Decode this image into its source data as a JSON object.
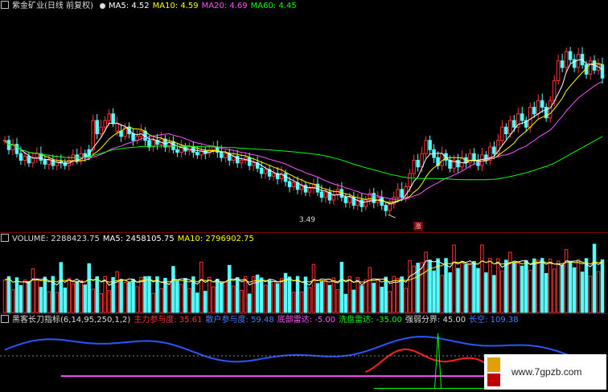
{
  "price_panel": {
    "stock_name": "紫金矿业(日线 前复权)",
    "ma_labels": [
      {
        "text": "MA5: 4.52",
        "color": "#ffffff"
      },
      {
        "text": "MA10: 4.59",
        "color": "#ffff00"
      },
      {
        "text": "MA20: 4.69",
        "color": "#ff55ff"
      },
      {
        "text": "MA60: 4.45",
        "color": "#00ff00"
      }
    ],
    "low_marker": "3.49",
    "badge": "涨"
  },
  "volume_panel": {
    "labels": [
      {
        "text": "VOLUME: 2288423.75",
        "color": "#dddddd"
      },
      {
        "text": "MA5: 2458105.75",
        "color": "#ffffff"
      },
      {
        "text": "MA10: 2796902.75",
        "color": "#ffff00"
      }
    ]
  },
  "indicator_panel": {
    "labels": [
      {
        "text": "黑客长刀指标(6,14,95,250,1,2)",
        "color": "#dddddd"
      },
      {
        "text": "主力参与度: 35.61",
        "color": "#ff3030"
      },
      {
        "text": "散户参与度: 59.48",
        "color": "#4a7dff"
      },
      {
        "text": "底部雷达: -5.00",
        "color": "#ff55ff"
      },
      {
        "text": "洗盘雷达: -35.00",
        "color": "#00ff00"
      },
      {
        "text": "强弱分界: 45.00",
        "color": "#dddddd"
      },
      {
        "text": "长空: 109.38",
        "color": "#4a7dff"
      }
    ]
  },
  "watermark": {
    "text": "www.7gpzb.com"
  },
  "colors": {
    "up": "#ff3232",
    "down": "#54ffff",
    "ma5": "#ffffff",
    "ma10": "#ffff00",
    "ma20": "#ff55ff",
    "ma60": "#00ff00",
    "main": "#ff2020",
    "retail": "#2a55ff"
  },
  "chart_data": [
    {
      "type": "candlestick",
      "title": "紫金矿业(日线 前复权)",
      "n": 150,
      "ylim": [
        3.4,
        5.0
      ],
      "low_label": 3.49,
      "ohlc_up": [
        true,
        false,
        true,
        false,
        false,
        true,
        false,
        true,
        true,
        false,
        false,
        true,
        false,
        true,
        false,
        false,
        true,
        true,
        false,
        true,
        false,
        false,
        true,
        false,
        true,
        true,
        true,
        false,
        true,
        false,
        true,
        false,
        false,
        true,
        true,
        false,
        false,
        true,
        false,
        true,
        false,
        true,
        false,
        false,
        true,
        false,
        true,
        false,
        false,
        true,
        false,
        true,
        true,
        false,
        false,
        true,
        false,
        true,
        false,
        true,
        true,
        false,
        true,
        false,
        false,
        true,
        false,
        true,
        false,
        true,
        false,
        false,
        true,
        false,
        true,
        false,
        true,
        true,
        false,
        false,
        true,
        false,
        true,
        true,
        false,
        false,
        true,
        false,
        true,
        false,
        true,
        true,
        false,
        true,
        false,
        false,
        true,
        true,
        true,
        false,
        true,
        true,
        true,
        false,
        true,
        true,
        false,
        false,
        false,
        true,
        false,
        false,
        true,
        false,
        true,
        false,
        true,
        false,
        false,
        true,
        false,
        true,
        false,
        true,
        true,
        false,
        true,
        false,
        true,
        false,
        false,
        true,
        false,
        true,
        false,
        false,
        true,
        true,
        true,
        false,
        true,
        false,
        false,
        true,
        false,
        false,
        true,
        false,
        true,
        false
      ],
      "close": [
        4.05,
        3.98,
        4.02,
        3.95,
        3.9,
        3.93,
        3.88,
        3.92,
        3.95,
        3.9,
        3.87,
        3.9,
        3.86,
        3.89,
        3.88,
        3.86,
        3.9,
        3.94,
        3.9,
        3.95,
        3.93,
        3.98,
        4.2,
        4.1,
        4.15,
        4.2,
        4.25,
        4.18,
        4.12,
        4.08,
        4.15,
        4.1,
        4.05,
        4.08,
        4.12,
        4.05,
        4.0,
        4.05,
        4.02,
        4.06,
        4.0,
        4.04,
        3.98,
        3.96,
        4.0,
        3.97,
        4.0,
        3.96,
        3.94,
        3.97,
        3.95,
        3.98,
        4.0,
        3.96,
        3.92,
        3.95,
        3.9,
        3.93,
        3.88,
        3.9,
        3.92,
        3.86,
        3.88,
        3.84,
        3.8,
        3.83,
        3.78,
        3.8,
        3.76,
        3.8,
        3.74,
        3.7,
        3.73,
        3.68,
        3.71,
        3.66,
        3.69,
        3.72,
        3.66,
        3.62,
        3.66,
        3.6,
        3.64,
        3.68,
        3.62,
        3.58,
        3.62,
        3.56,
        3.6,
        3.55,
        3.6,
        3.65,
        3.58,
        3.62,
        3.56,
        3.52,
        3.57,
        3.62,
        3.68,
        3.62,
        3.7,
        3.8,
        3.9,
        3.85,
        3.95,
        4.05,
        3.98,
        3.92,
        3.86,
        3.95,
        3.9,
        3.84,
        3.9,
        3.85,
        3.92,
        3.88,
        3.95,
        3.9,
        3.86,
        3.94,
        3.9,
        4.0,
        3.95,
        4.05,
        4.15,
        4.1,
        4.2,
        4.15,
        4.25,
        4.2,
        4.15,
        4.3,
        4.25,
        4.35,
        4.3,
        4.22,
        4.35,
        4.5,
        4.65,
        4.6,
        4.72,
        4.66,
        4.6,
        4.7,
        4.62,
        4.55,
        4.65,
        4.58,
        4.62,
        4.52
      ]
    },
    {
      "type": "bar",
      "title": "VOLUME",
      "n": 150
    },
    {
      "type": "line",
      "title": "黑客长刀指标(6,14,95,250,1,2)",
      "series": [
        {
          "name": "主力参与度",
          "value": 35.61
        },
        {
          "name": "散户参与度",
          "value": 59.48
        },
        {
          "name": "底部雷达",
          "value": -5.0
        },
        {
          "name": "洗盘雷达",
          "value": -35.0
        },
        {
          "name": "强弱分界",
          "value": 45.0
        },
        {
          "name": "长空",
          "value": 109.38
        }
      ]
    }
  ]
}
